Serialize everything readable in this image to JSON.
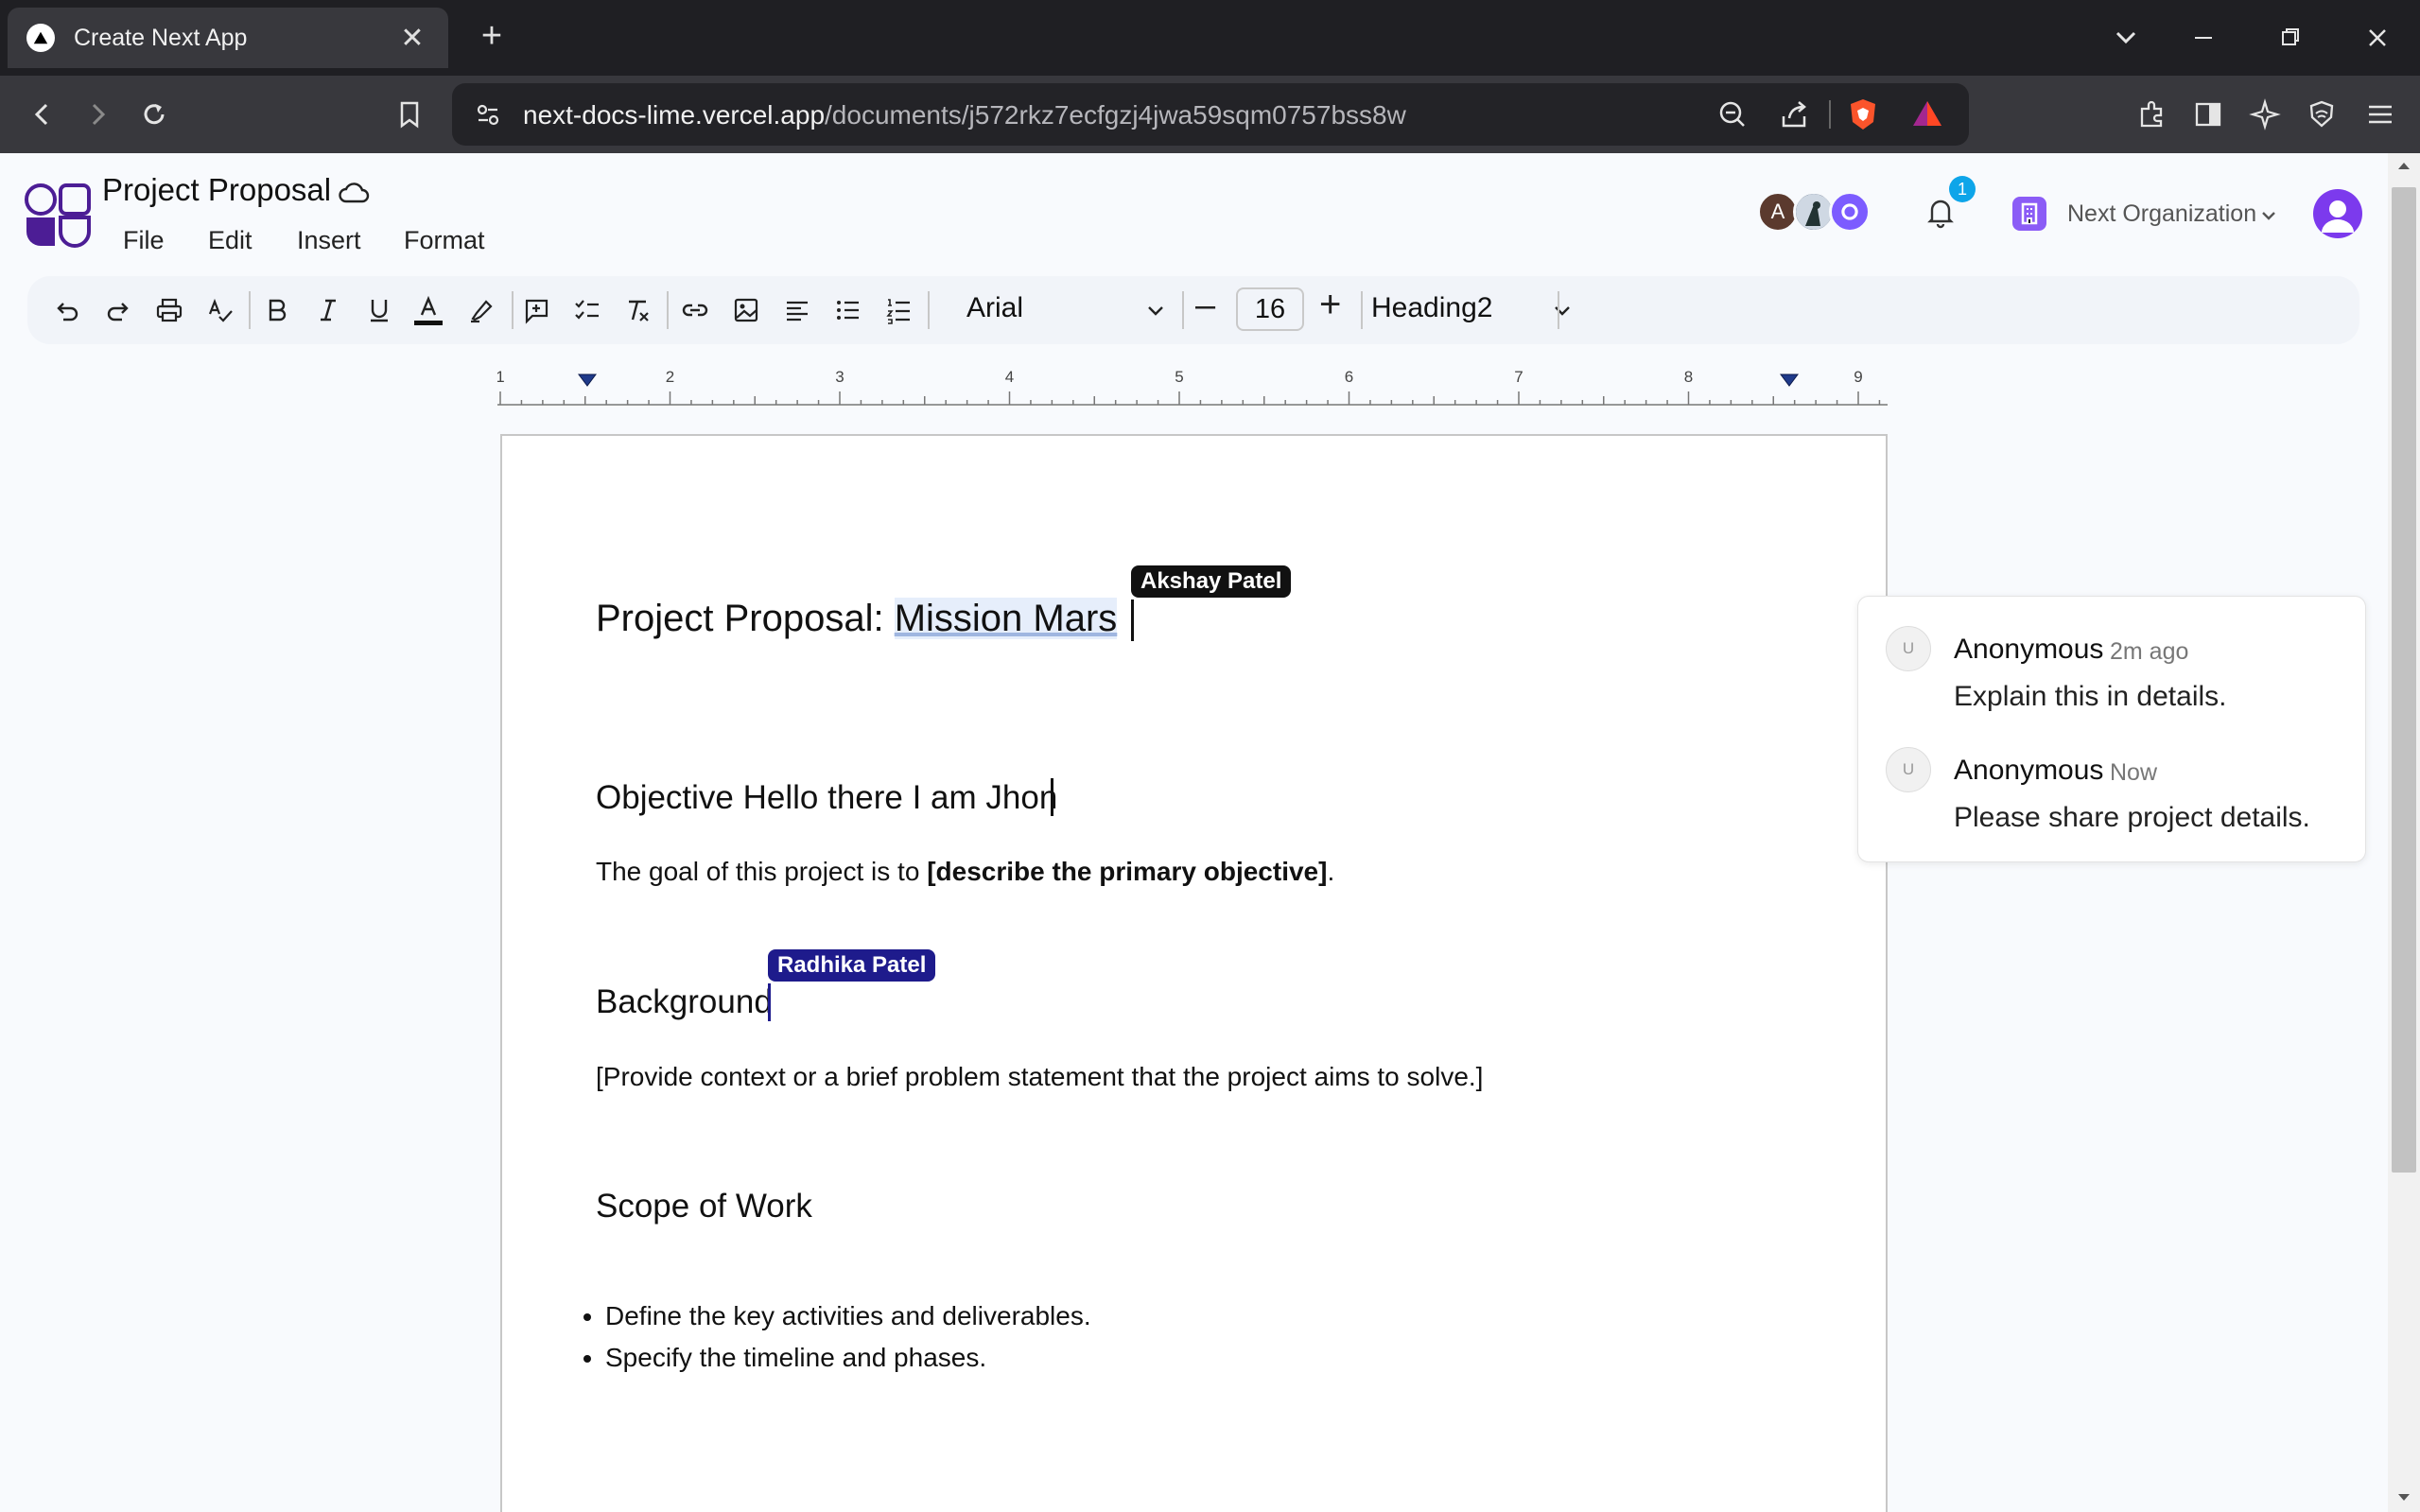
{
  "browser": {
    "tab_title": "Create Next App",
    "url_domain": "next-docs-lime.vercel.app",
    "url_path": "/documents/j572rkz7ecfgzj4jwa59sqm0757bss8w"
  },
  "app": {
    "doc_title": "Project Proposal",
    "menu": [
      "File",
      "Edit",
      "Insert",
      "Format"
    ],
    "avatar_initial": "A",
    "notification_count": "1",
    "organization": "Next Organization"
  },
  "toolbar": {
    "font_family": "Arial",
    "font_size": "16",
    "heading": "Heading2",
    "size_minus": "–",
    "size_plus": "+"
  },
  "ruler": {
    "labels": [
      "1",
      "2",
      "3",
      "4",
      "5",
      "6",
      "7",
      "8",
      "9"
    ]
  },
  "document": {
    "title_prefix": "Project Proposal: ",
    "title_highlight": "Mission Mars",
    "objective_heading": "Objective Hello there I am Jhon",
    "goal_prefix": "The goal of this project is to ",
    "goal_bold": "[describe the primary objective]",
    "goal_suffix": ".",
    "background_heading": "Background",
    "background_text": "[Provide context or a brief problem statement that the project aims to solve.]",
    "scope_heading": "Scope of Work",
    "bullets": [
      "Define the key activities and deliverables.",
      "Specify the timeline and phases."
    ]
  },
  "collaborators": {
    "cursor1": "Akshay Patel",
    "cursor2": "Radhika Patel"
  },
  "comments": [
    {
      "avatar": "U",
      "author": "Anonymous",
      "time": "2m ago",
      "text": "Explain this in details."
    },
    {
      "avatar": "U",
      "author": "Anonymous",
      "time": "Now",
      "text": "Please share project details."
    }
  ],
  "colors": {
    "brand": "#4c1d95",
    "cursor1": "#111111",
    "cursor2": "#1e1b8c",
    "accent": "#0ea5e9"
  }
}
